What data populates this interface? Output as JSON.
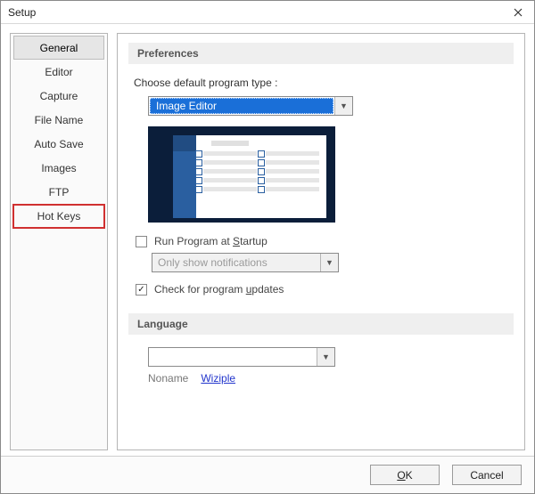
{
  "dialog": {
    "title": "Setup"
  },
  "sidebar": {
    "items": [
      {
        "label": "General",
        "selected": true
      },
      {
        "label": "Editor",
        "selected": false
      },
      {
        "label": "Capture",
        "selected": false
      },
      {
        "label": "File Name",
        "selected": false
      },
      {
        "label": "Auto Save",
        "selected": false
      },
      {
        "label": "Images",
        "selected": false
      },
      {
        "label": "FTP",
        "selected": false
      },
      {
        "label": "Hot Keys",
        "selected": false,
        "highlighted": true
      }
    ]
  },
  "prefs": {
    "section_title": "Preferences",
    "default_type_label": "Choose default program type :",
    "default_type_value": "Image Editor",
    "run_at_startup_label": "Run Program at Startup",
    "run_at_startup_checked": false,
    "startup_mode_value": "Only show notifications",
    "startup_mode_disabled": true,
    "check_updates_label": "Check for program updates",
    "check_updates_checked": true
  },
  "language": {
    "section_title": "Language",
    "combo_value": "",
    "noname_label": "Noname",
    "link_label": "Wiziple"
  },
  "footer": {
    "ok_label": "OK",
    "cancel_label": "Cancel"
  }
}
